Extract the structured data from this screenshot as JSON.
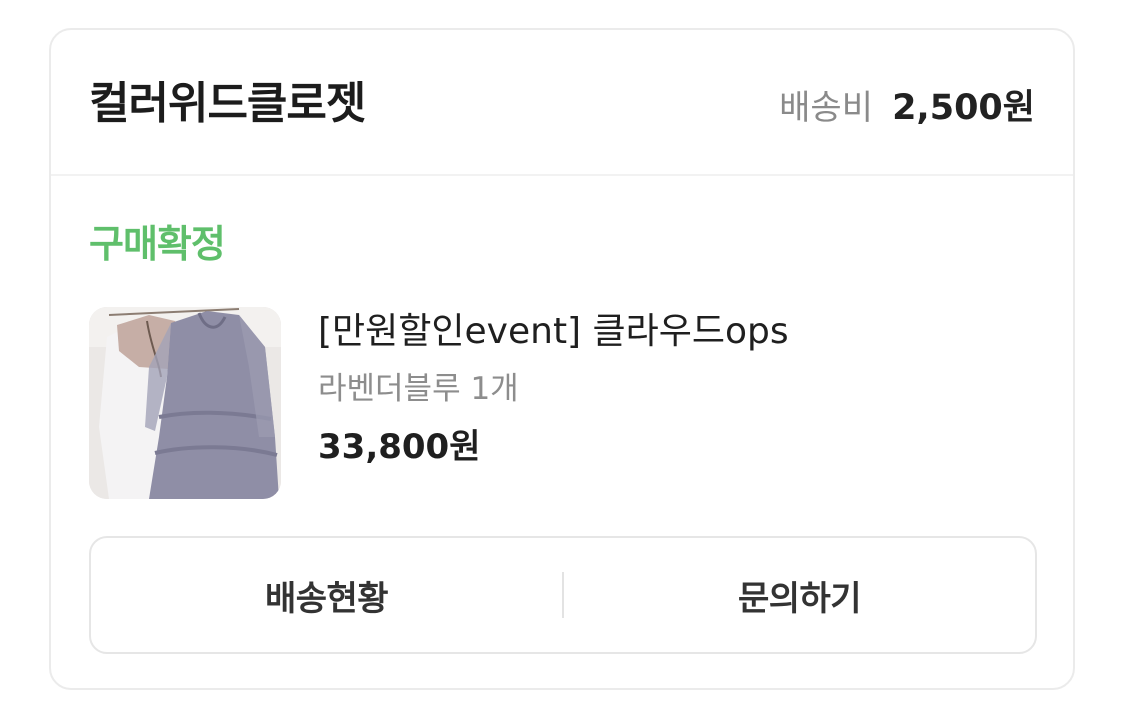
{
  "store": {
    "name": "컬러위드클로젯",
    "shipping_label": "배송비",
    "shipping_fee": "2,500원"
  },
  "order": {
    "status": "구매확정",
    "status_color": "#5fbf6b"
  },
  "product": {
    "name": "[만원할인event] 클라우드ops",
    "option": "라벤더블루 1개",
    "price": "33,800원",
    "thumbnail_icon": "dress-photo"
  },
  "actions": {
    "delivery_status": "배송현황",
    "inquiry": "문의하기"
  }
}
